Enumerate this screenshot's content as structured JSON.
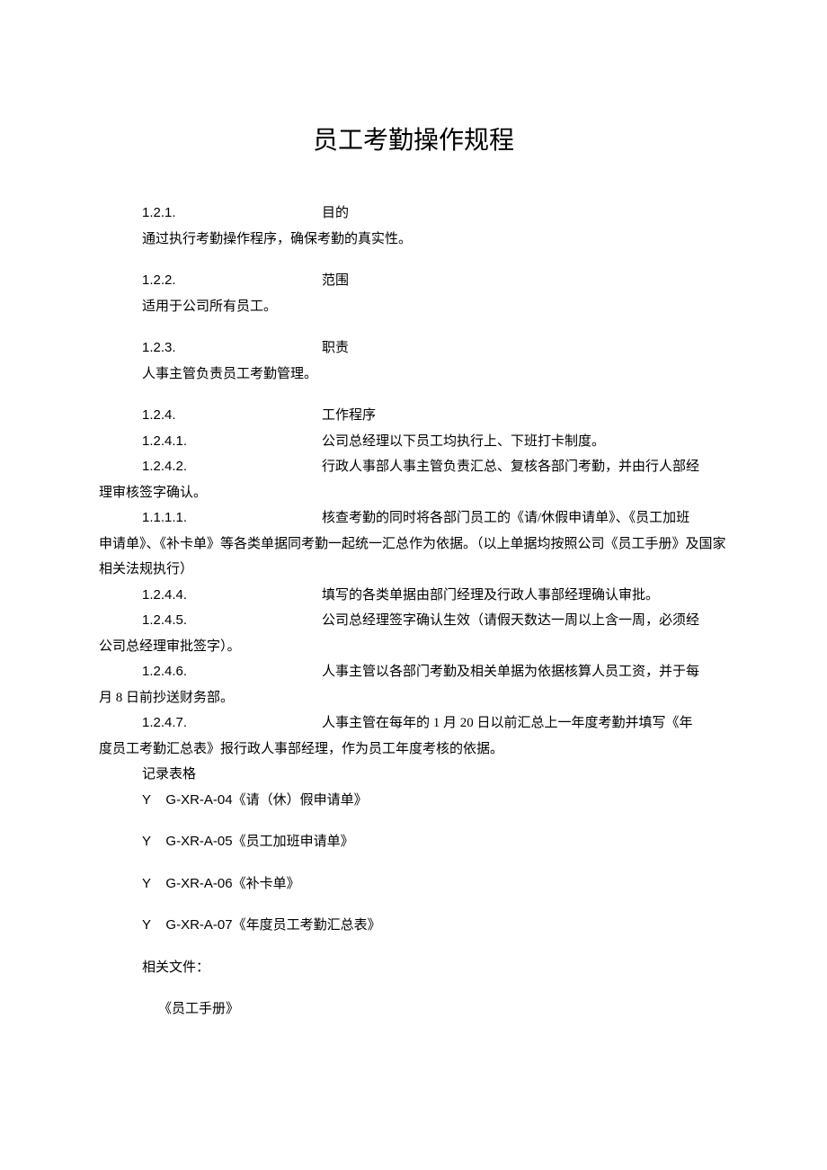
{
  "title": "员工考勤操作规程",
  "sections": {
    "s1": {
      "num": "1.2.1.",
      "head": "目的",
      "body": "通过执行考勤操作程序，确保考勤的真实性。"
    },
    "s2": {
      "num": "1.2.2.",
      "head": "范围",
      "body": "适用于公司所有员工。"
    },
    "s3": {
      "num": "1.2.3.",
      "head": "职责",
      "body": "人事主管负责员工考勤管理。"
    },
    "s4": {
      "num": "1.2.4.",
      "head": "工作程序"
    },
    "s41": {
      "num": "1.2.4.1.",
      "text": "公司总经理以下员工均执行上、下班打卡制度。"
    },
    "s42": {
      "num": "1.2.4.2.",
      "text": "行政人事部人事主管负责汇总、复核各部门考勤，并由行人部经"
    },
    "s42_cont": "理审核签字确认。",
    "s1111": {
      "num": "1.1.1.1.",
      "text": "核查考勤的同时将各部门员工的《请/休假申请单》、《员工加班"
    },
    "s1111_cont": "申请单》、《补卡单》等各类单据同考勤一起统一汇总作为依据。（以上单据均按照公司《员工手册》及国家相关法规执行）",
    "s44": {
      "num": "1.2.4.4.",
      "text": "填写的各类单据由部门经理及行政人事部经理确认审批。"
    },
    "s45": {
      "num": "1.2.4.5.",
      "text": "公司总经理签字确认生效（请假天数达一周以上含一周，必须经"
    },
    "s45_cont": "公司总经理审批签字）。",
    "s46": {
      "num": "1.2.4.6.",
      "text": "人事主管以各部门考勤及相关单据为依据核算人员工资，并于每"
    },
    "s46_cont": "月 8 日前抄送财务部。",
    "s47": {
      "num": "1.2.4.7.",
      "text": "人事主管在每年的 1 月 20 日以前汇总上一年度考勤并填写《年"
    },
    "s47_cont": "度员工考勤汇总表》报行政人事部经理，作为员工年度考核的依据。"
  },
  "records": {
    "label": "记录表格",
    "items": {
      "r1": "Y    G-XR-A-04《请（休）假申请单》",
      "r2": "Y    G-XR-A-05《员工加班申请单》",
      "r3": "Y    G-XR-A-06《补卡单》",
      "r4": "Y    G-XR-A-07《年度员工考勤汇总表》"
    }
  },
  "related": {
    "label": "相关文件：",
    "doc": "《员工手册》"
  }
}
